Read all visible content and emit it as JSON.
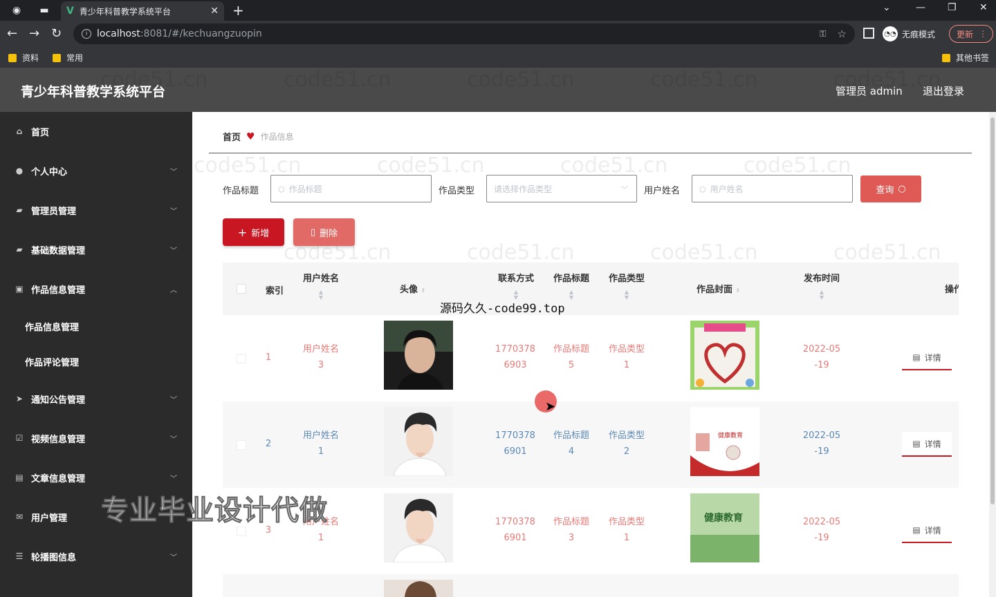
{
  "browser": {
    "tab_title": "青少年科普教学系统平台",
    "url_host": "localhost",
    "url_path": ":8081/#/kechuangzuopin",
    "incognito_label": "无痕模式",
    "update_label": "更新",
    "bookmarks": [
      "资料",
      "常用"
    ],
    "other_bookmarks": "其他书签"
  },
  "header": {
    "title": "青少年科普教学系统平台",
    "admin": "管理员 admin",
    "logout": "退出登录"
  },
  "sidebar": {
    "items": [
      {
        "label": "首页",
        "icon": "home-icon"
      },
      {
        "label": "个人中心",
        "icon": "user-icon"
      },
      {
        "label": "管理员管理",
        "icon": "admin-icon"
      },
      {
        "label": "基础数据管理",
        "icon": "data-icon"
      },
      {
        "label": "作品信息管理",
        "icon": "chat-icon"
      },
      {
        "label": "通知公告管理",
        "icon": "send-icon"
      },
      {
        "label": "视频信息管理",
        "icon": "check-icon"
      },
      {
        "label": "文章信息管理",
        "icon": "doc-icon"
      },
      {
        "label": "用户管理",
        "icon": "mail-icon"
      },
      {
        "label": "轮播图信息",
        "icon": "sliders-icon"
      }
    ],
    "submenu": [
      "作品信息管理",
      "作品评论管理"
    ]
  },
  "breadcrumb": {
    "home": "首页",
    "current": "作品信息"
  },
  "filters": {
    "title_label": "作品标题",
    "title_placeholder": "作品标题",
    "type_label": "作品类型",
    "type_placeholder": "请选择作品类型",
    "user_label": "用户姓名",
    "user_placeholder": "用户姓名",
    "search_button": "查询"
  },
  "actions": {
    "add": "新增",
    "delete": "删除"
  },
  "table": {
    "headers": {
      "index": "索引",
      "username": "用户姓名",
      "avatar": "头像",
      "phone": "联系方式",
      "title": "作品标题",
      "type": "作品类型",
      "cover": "作品封面",
      "time": "发布时间",
      "ops": "操作"
    },
    "rows": [
      {
        "index": "1",
        "user_a": "用户姓名",
        "user_b": "3",
        "phone_a": "1770378",
        "phone_b": "6903",
        "title_a": "作品标题",
        "title_b": "5",
        "type_a": "作品类型",
        "type_b": "1",
        "time_a": "2022-05",
        "time_b": "-19",
        "detail": "详情"
      },
      {
        "index": "2",
        "user_a": "用户姓名",
        "user_b": "1",
        "phone_a": "1770378",
        "phone_b": "6901",
        "title_a": "作品标题",
        "title_b": "4",
        "type_a": "作品类型",
        "type_b": "2",
        "time_a": "2022-05",
        "time_b": "-19",
        "detail": "详情"
      },
      {
        "index": "3",
        "user_a": "用户姓名",
        "user_b": "1",
        "phone_a": "1770378",
        "phone_b": "6901",
        "title_a": "作品标题",
        "title_b": "3",
        "type_a": "作品类型",
        "type_b": "1",
        "time_a": "2022-05",
        "time_b": "-19",
        "detail": "详情"
      }
    ]
  },
  "cover_texts": {
    "c2": "健康教育",
    "c3": "健康教育"
  },
  "overlays": {
    "site_text": "源码久久-code99.top",
    "watermark": "专业毕业设计代做",
    "grid_watermark": "code51.cn"
  },
  "colors": {
    "primary": "#c81623",
    "header": "#4a4a4a",
    "sidebar": "#2b2b2b"
  }
}
